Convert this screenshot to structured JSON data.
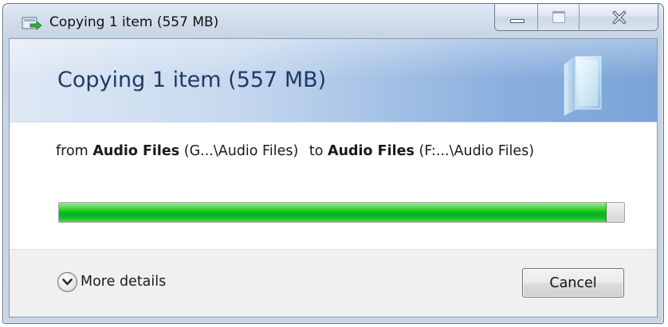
{
  "window": {
    "title": "Copying 1 item (557 MB)",
    "icon": "copy-files-icon",
    "controls": {
      "minimize": "minimize-icon",
      "maximize": "maximize-icon",
      "close": "close-icon"
    }
  },
  "header": {
    "text": "Copying 1 item (557 MB)",
    "graphic": "copy-document-icon"
  },
  "transfer": {
    "from_word": "from",
    "source_name": "Audio Files",
    "source_path": "(G...\\Audio Files)",
    "to_word": "to",
    "dest_name": "Audio Files",
    "dest_path": "(F:...\\Audio Files)"
  },
  "progress": {
    "fraction": 0.967,
    "fill_color": "#06b025"
  },
  "footer": {
    "more_details_label": "More details",
    "more_details_icon": "chevron-down-circle-icon",
    "cancel_label": "Cancel"
  }
}
